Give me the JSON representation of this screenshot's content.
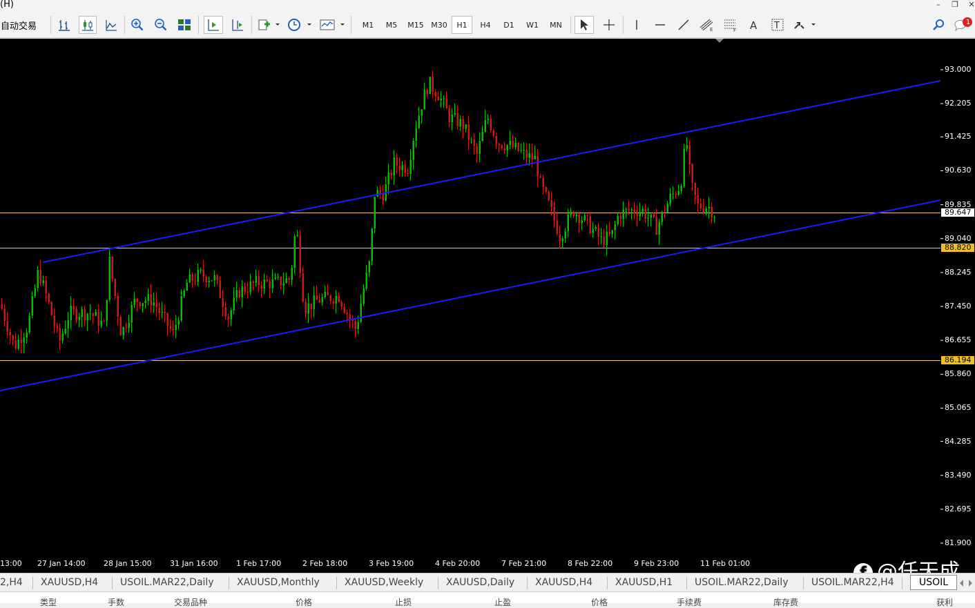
{
  "menu": {
    "label": "(H)"
  },
  "toolbar": {
    "auto_trade_label": "自动交易",
    "timeframes": [
      "M1",
      "M5",
      "M15",
      "M30",
      "H1",
      "H4",
      "D1",
      "W1",
      "MN"
    ],
    "active_timeframe": "H1",
    "notification_count": "1"
  },
  "chart": {
    "symbol": "USOIL",
    "background": "#000000",
    "bull_color": "#00c000",
    "bear_color": "#d01818",
    "channel_color": "#1a1aff",
    "hline_color": "#f0c878",
    "y_ticks": [
      "93.000",
      "92.205",
      "91.425",
      "90.630",
      "89.835",
      "89.040",
      "88.245",
      "87.450",
      "86.655",
      "85.860",
      "85.065",
      "84.285",
      "83.490",
      "82.695",
      "81.900"
    ],
    "current_price": "89.647",
    "hline_labels": [
      "88.820",
      "86.194"
    ],
    "x_ticks": [
      "13:00",
      "27 Jan 14:00",
      "28 Jan 15:00",
      "31 Jan 16:00",
      "1 Feb 17:00",
      "2 Feb 18:00",
      "3 Feb 19:00",
      "4 Feb 20:00",
      "7 Feb 21:00",
      "8 Feb 22:00",
      "9 Feb 23:00",
      "11 Feb 01:00"
    ]
  },
  "tabs": [
    "2,H4",
    "XAUUSD,H4",
    "USOIL.MAR22,Daily",
    "XAUUSD,Monthly",
    "XAUUSD,Weekly",
    "XAUUSD,Daily",
    "XAUUSD,H4",
    "XAUUSD,H1",
    "USOIL.MAR22,Daily",
    "USOIL.MAR22,H4",
    "USOIL"
  ],
  "bottom_labels": [
    "类型",
    "手数",
    "交易品种",
    "价格",
    "止损",
    "止盈",
    "价格",
    "手续费",
    "库存费",
    "获利"
  ],
  "watermark": "@任天成",
  "watermark_icon": "facebook-icon"
}
